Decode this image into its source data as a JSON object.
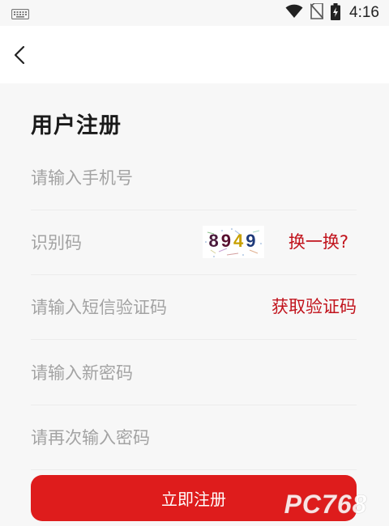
{
  "status_bar": {
    "time": "4:16",
    "icons": [
      "keyboard-icon",
      "wifi-icon",
      "no-sim-icon",
      "battery-charging-icon"
    ]
  },
  "nav": {
    "back_icon": "chevron-left-icon"
  },
  "form": {
    "title": "用户注册",
    "phone_placeholder": "请输入手机号",
    "captcha_placeholder": "识别码",
    "captcha_code": "8949",
    "captcha_refresh_label": "换一换?",
    "sms_code_placeholder": "请输入短信验证码",
    "get_sms_code_label": "获取验证码",
    "new_password_placeholder": "请输入新密码",
    "confirm_password_placeholder": "请再次输入密码",
    "submit_label": "立即注册"
  },
  "colors": {
    "accent": "#de1c1c",
    "link": "#c1131c",
    "placeholder": "#a3a3a3",
    "background": "#f7f7f7"
  },
  "watermark": {
    "text": "PC768"
  }
}
